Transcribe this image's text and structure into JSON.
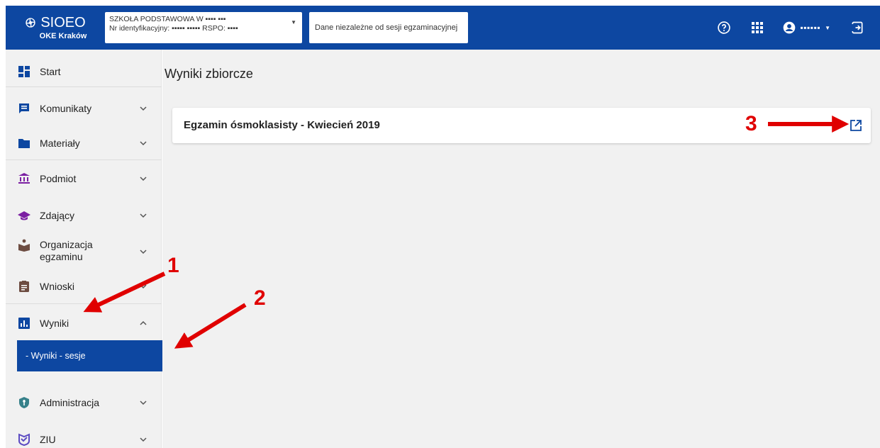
{
  "brand": {
    "name": "SIOEO",
    "subtitle": "OKE Kraków"
  },
  "school": {
    "line1": "SZKOŁA PODSTAWOWA W ▪▪▪▪ ▪▪▪",
    "line2_prefix": "Nr identyfikacyjny: ",
    "line2_id": "▪▪▪▪▪ ▪▪▪▪▪",
    "line2_rspo_label": " RSPO: ",
    "line2_rspo": "▪▪▪▪"
  },
  "session_selector": "Dane niezależne od sesji egzaminacyjnej",
  "user": {
    "name": "▪▪▪▪▪▪"
  },
  "sidebar": {
    "items": [
      {
        "label": "Start",
        "icon": "dashboard-icon"
      },
      {
        "label": "Komunikaty",
        "icon": "message-icon"
      },
      {
        "label": "Materiały",
        "icon": "folder-icon"
      },
      {
        "label": "Podmiot",
        "icon": "institution-icon"
      },
      {
        "label": "Zdający",
        "icon": "graduation-cap-icon"
      },
      {
        "label": "Organizacja",
        "label2": "egzaminu",
        "icon": "organization-icon"
      },
      {
        "label": "Wnioski",
        "icon": "clipboard-icon"
      },
      {
        "label": "Wyniki",
        "icon": "bar-chart-icon"
      },
      {
        "label": "Administracja",
        "icon": "shield-icon"
      },
      {
        "label": "ZIU",
        "icon": "ziu-icon"
      }
    ],
    "subitem": "- Wyniki - sesje"
  },
  "main": {
    "title": "Wyniki zbiorcze",
    "card_title": "Egzamin ósmoklasisty - Kwiecień 2019"
  },
  "annotations": [
    "1",
    "2",
    "3"
  ],
  "colors": {
    "primary": "#0d47a1",
    "annotation": "#e00000",
    "background": "#f1f1f1"
  }
}
